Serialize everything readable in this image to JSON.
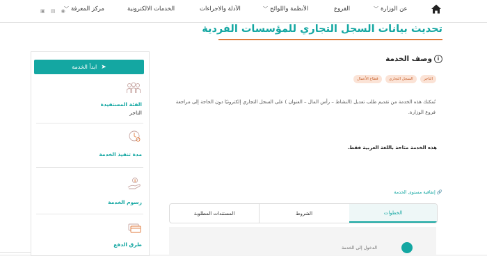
{
  "nav": {
    "items": [
      {
        "label": "عن الوزارة",
        "chevron": true
      },
      {
        "label": "الفروع",
        "chevron": false
      },
      {
        "label": "الأنظمة واللوائح",
        "chevron": true
      },
      {
        "label": "الأدلة والاجراءات",
        "chevron": false
      },
      {
        "label": "الخدمات الالكترونية",
        "chevron": false
      },
      {
        "label": "مركز المعرفة",
        "chevron": true
      }
    ]
  },
  "page": {
    "title": "تحديث بيانات السجل التجاري للمؤسسات الفردية"
  },
  "sidebar": {
    "start_button": "ابدأ الخدمة",
    "beneficiary_label": "الفئة المستفيدة",
    "beneficiary_value": "التاجر",
    "duration_label": "مدة تنفيذ الخدمة",
    "fees_label": "رسوم الخدمة",
    "payment_label": "طرق الدفع"
  },
  "service": {
    "heading": "وصف الخدمة",
    "tags": [
      "التاجر",
      "السجل التجاري",
      "قطاع الأعمال"
    ],
    "description": "تُمكنك هذه الخدمة من تقديم طلب تعديل (النشاط – رأس المال – العنوان ) على السجل التجاري إلكترونيًا دون الحاجة إلى مراجعة فروع الوزارة.",
    "note": "هذه الخدمة متاحة باللغة العربية فقط.",
    "sla_link": "إتفاقية مستوى الخدمة"
  },
  "tabs": [
    "الخطوات",
    "الشروط",
    "المستندات المطلوبة"
  ],
  "steps": {
    "first": "الدخول إلى الخدمة"
  },
  "colors": {
    "accent": "#14a7a2",
    "title_underline": "#e07a3b",
    "tag_bg": "#fbe3d6",
    "tag_text": "#c9632f"
  }
}
